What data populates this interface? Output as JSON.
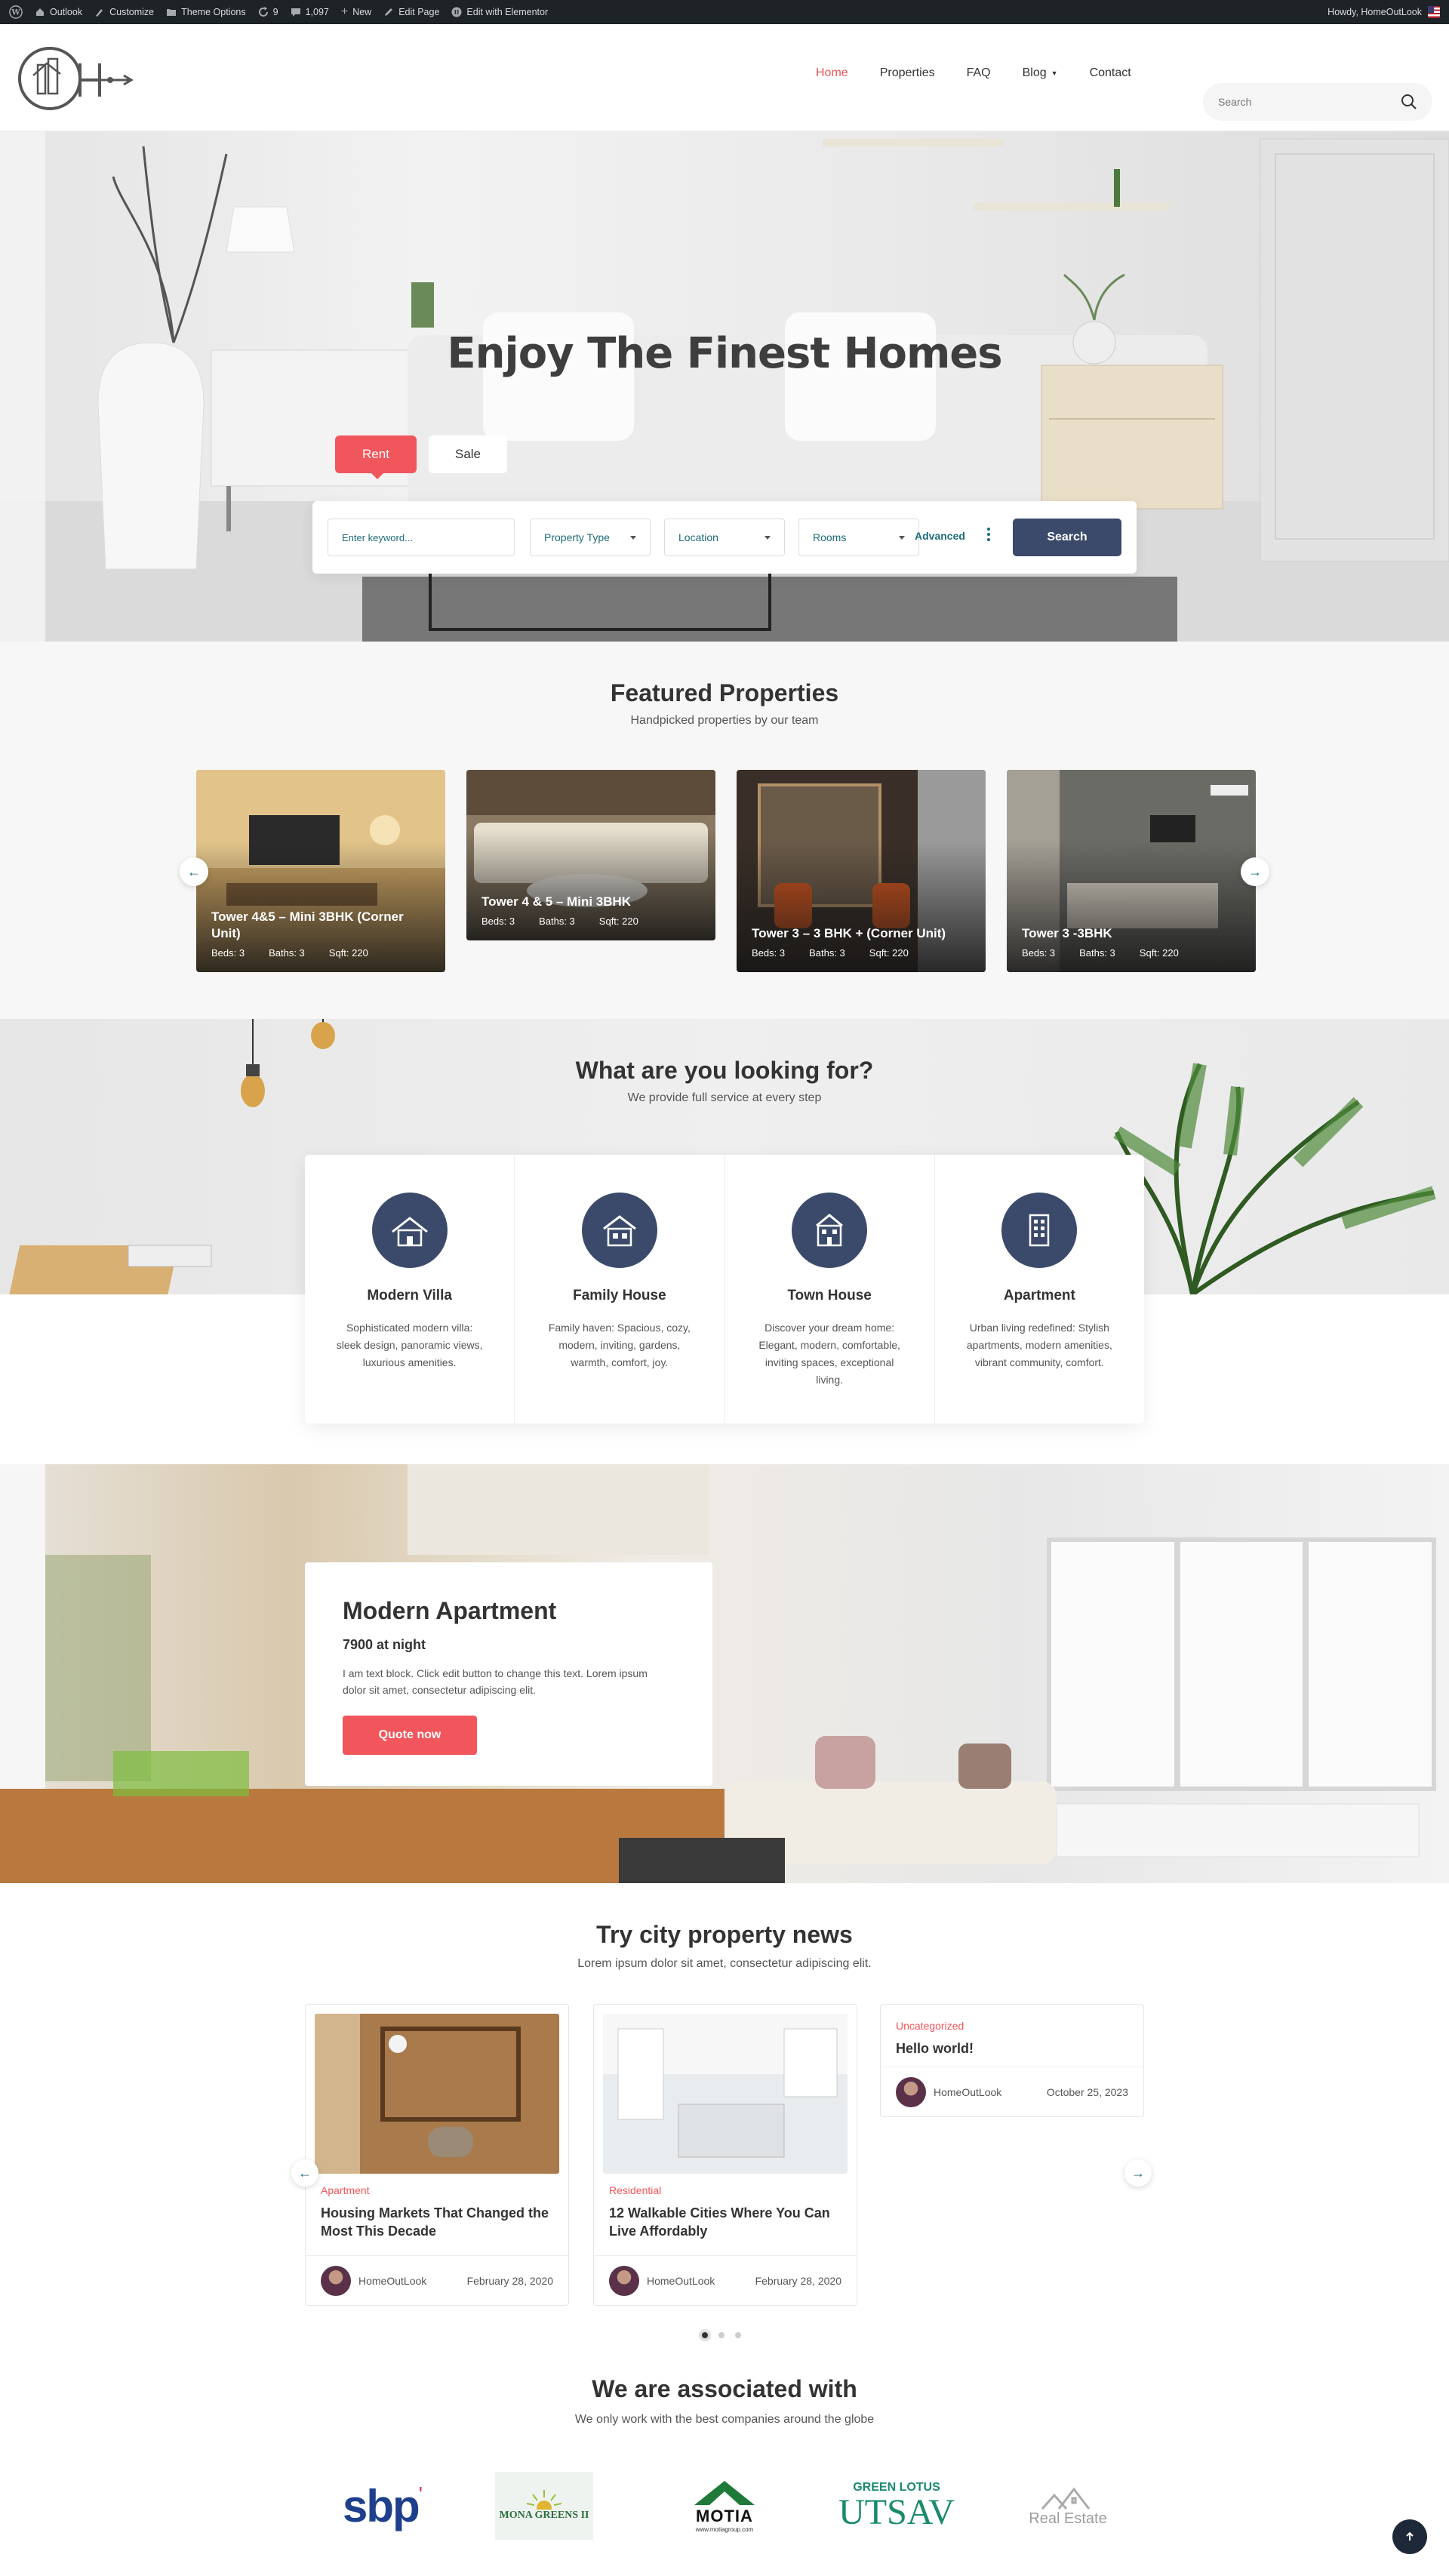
{
  "admin_bar": {
    "site_name": "Outlook",
    "customize": "Customize",
    "theme_options": "Theme Options",
    "updates_count": "9",
    "comments_count": "1,097",
    "new": "New",
    "edit_page": "Edit Page",
    "edit_elementor": "Edit with Elementor",
    "howdy": "Howdy, HomeOutLook"
  },
  "nav": {
    "items": [
      "Home",
      "Properties",
      "FAQ",
      "Blog",
      "Contact"
    ],
    "active": "Home",
    "search_placeholder": "Search"
  },
  "hero": {
    "title": "Enjoy The Finest Homes",
    "tabs": [
      "Rent",
      "Sale"
    ],
    "keyword_placeholder": "Enter keyword...",
    "property_type": "Property Type",
    "location": "Location",
    "rooms": "Rooms",
    "advanced": "Advanced",
    "search_button": "Search"
  },
  "featured": {
    "title": "Featured Properties",
    "subtitle": "Handpicked properties by our team",
    "cards": [
      {
        "title": "Tower 4&5 – Mini 3BHK (Corner Unit)",
        "beds": "Beds: 3",
        "baths": "Baths: 3",
        "sqft": "Sqft: 220"
      },
      {
        "title": "Tower 4 & 5 – Mini 3BHK",
        "beds": "Beds: 3",
        "baths": "Baths: 3",
        "sqft": "Sqft: 220"
      },
      {
        "title": "Tower 3 – 3 BHK + (Corner Unit)",
        "beds": "Beds: 3",
        "baths": "Baths: 3",
        "sqft": "Sqft: 220"
      },
      {
        "title": "Tower 3 -3BHK",
        "beds": "Beds: 3",
        "baths": "Baths: 3",
        "sqft": "Sqft: 220"
      }
    ]
  },
  "looking": {
    "title": "What are you looking for?",
    "subtitle": "We provide full service at every step",
    "services": [
      {
        "name": "Modern Villa",
        "text": "Sophisticated modern villa: sleek design, panoramic views, luxurious amenities."
      },
      {
        "name": "Family House",
        "text": "Family haven: Spacious, cozy, modern, inviting, gardens, warmth, comfort, joy."
      },
      {
        "name": "Town House",
        "text": "Discover your dream home: Elegant, modern, comfortable, inviting spaces, exceptional living."
      },
      {
        "name": "Apartment",
        "text": "Urban living redefined: Stylish apartments, modern amenities, vibrant community, comfort."
      }
    ]
  },
  "apartment": {
    "title": "Modern Apartment",
    "price": "7900 at night",
    "text": "I am text block. Click edit button to change this text. Lorem ipsum dolor sit amet, consectetur adipiscing elit.",
    "button": "Quote now"
  },
  "news": {
    "title": "Try city property news",
    "subtitle": "Lorem ipsum dolor sit amet, consectetur adipiscing elit.",
    "posts": [
      {
        "category": "Apartment",
        "title": "Housing Markets That Changed the Most This Decade",
        "author": "HomeOutLook",
        "date": "February 28, 2020"
      },
      {
        "category": "Residential",
        "title": "12 Walkable Cities Where You Can Live Affordably",
        "author": "HomeOutLook",
        "date": "February 28, 2020"
      },
      {
        "category": "Uncategorized",
        "title": "Hello world!",
        "author": "HomeOutLook",
        "date": "October 25, 2023"
      }
    ]
  },
  "associated": {
    "title": "We are associated with",
    "subtitle": "We only work with the best companies around the globe",
    "partners": [
      {
        "name": "sbp"
      },
      {
        "name": "MONA GREENS II"
      },
      {
        "name": "MOTIA",
        "sub": "www.motiagroup.com"
      },
      {
        "name": "GREEN LOTUS",
        "sub": "UTSAV"
      },
      {
        "name": "Real Estate"
      }
    ]
  },
  "colors": {
    "accent": "#f0565b",
    "navy": "#3b4a6b",
    "teal": "#1d6b78"
  }
}
